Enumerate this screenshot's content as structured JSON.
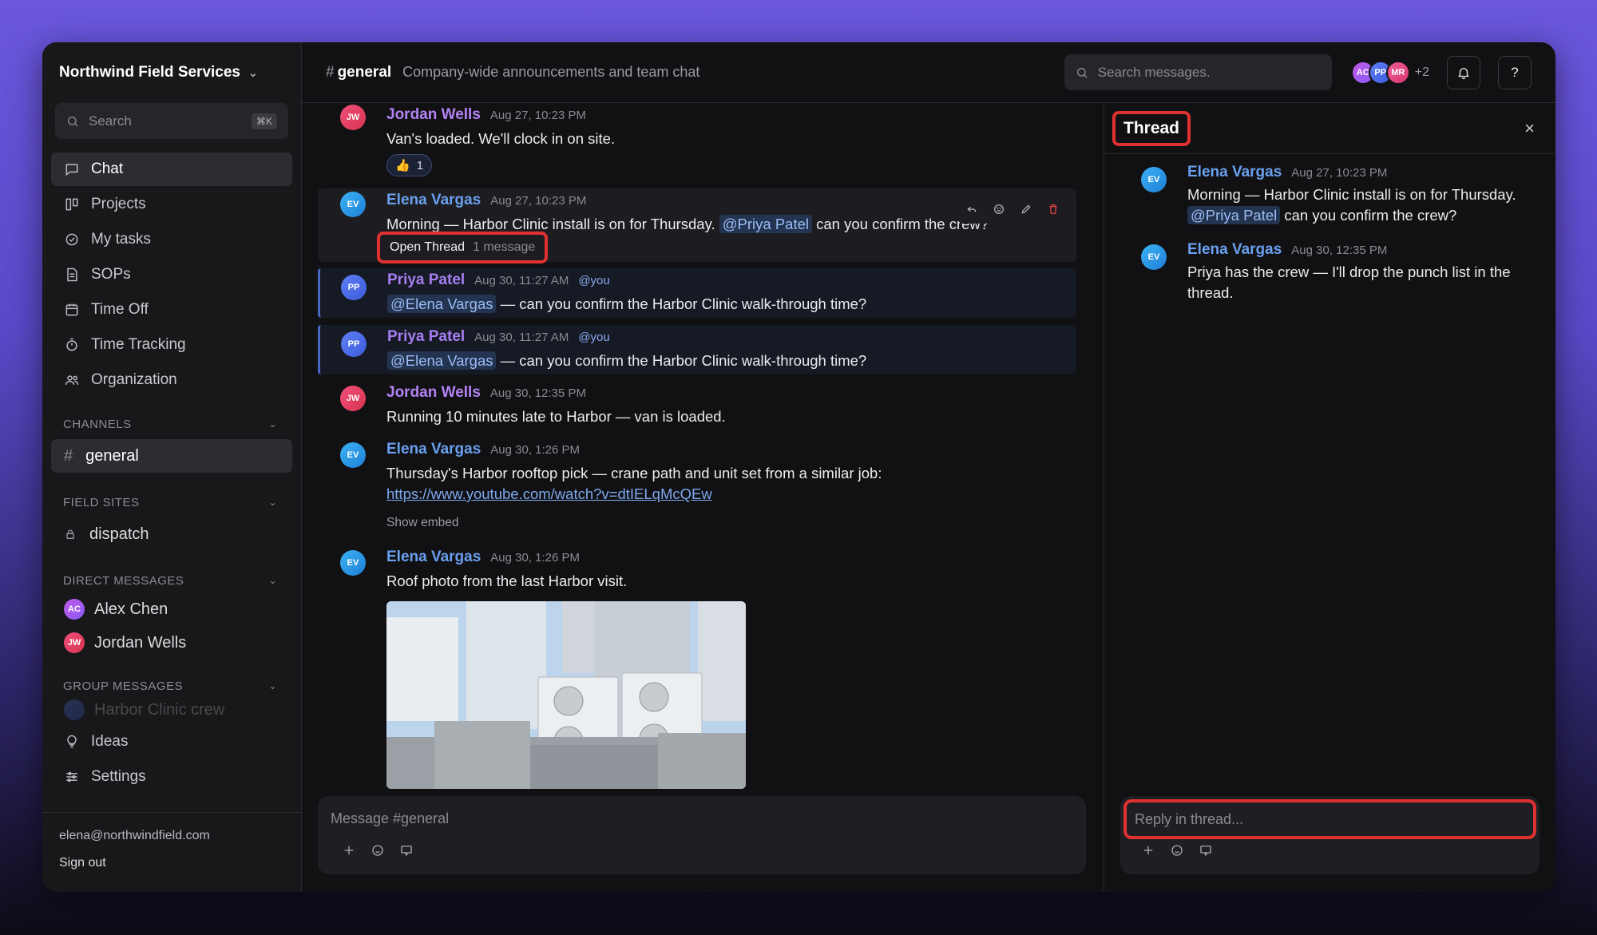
{
  "workspace": {
    "name": "Northwind Field Services"
  },
  "sidebar": {
    "search_placeholder": "Search",
    "search_shortcut": "⌘K",
    "nav": [
      {
        "label": "Chat"
      },
      {
        "label": "Projects"
      },
      {
        "label": "My tasks"
      },
      {
        "label": "SOPs"
      },
      {
        "label": "Time Off"
      },
      {
        "label": "Time Tracking"
      },
      {
        "label": "Organization"
      }
    ],
    "channels_label": "CHANNELS",
    "channels": [
      {
        "name": "general"
      }
    ],
    "field_sites_label": "FIELD SITES",
    "field_sites": [
      {
        "name": "dispatch"
      }
    ],
    "dm_label": "DIRECT MESSAGES",
    "dms": [
      {
        "initials": "AC",
        "name": "Alex Chen"
      },
      {
        "initials": "JW",
        "name": "Jordan Wells"
      }
    ],
    "group_label": "GROUP MESSAGES",
    "groups": [
      {
        "name": "Harbor Clinic crew"
      }
    ],
    "bottom_nav": [
      {
        "label": "Ideas"
      },
      {
        "label": "Settings"
      }
    ],
    "footer": {
      "email": "elena@northwindfield.com",
      "signout": "Sign out"
    }
  },
  "header": {
    "channel": "general",
    "hash": "#",
    "description": "Company-wide announcements and team chat",
    "search_placeholder": "Search messages.",
    "members": [
      "AC",
      "PP",
      "MR"
    ],
    "extra_members": "+2",
    "help": "?"
  },
  "messages": [
    {
      "initials": "JW",
      "author": "Jordan Wells",
      "time": "Aug 27, 10:23 PM",
      "text": "Van's loaded. We'll clock in on site.",
      "reaction_emoji": "👍",
      "reaction_count": "1"
    },
    {
      "initials": "EV",
      "author": "Elena Vargas",
      "time": "Aug 27, 10:23 PM",
      "text_before": "Morning — Harbor Clinic install is on for Thursday.",
      "mention": "@Priya Patel",
      "text_after": "can you confirm the crew?",
      "thread_label": "Open Thread",
      "thread_count": "1 message"
    },
    {
      "initials": "PP",
      "author": "Priya Patel",
      "time": "Aug 30, 11:27 AM",
      "you_tag": "@you",
      "mention": "@Elena Vargas",
      "text_after": "— can you confirm the Harbor Clinic walk-through time?"
    },
    {
      "initials": "PP",
      "author": "Priya Patel",
      "time": "Aug 30, 11:27 AM",
      "you_tag": "@you",
      "mention": "@Elena Vargas",
      "text_after": "— can you confirm the Harbor Clinic walk-through time?"
    },
    {
      "initials": "JW",
      "author": "Jordan Wells",
      "time": "Aug 30, 12:35 PM",
      "text": "Running 10 minutes late to Harbor — van is loaded."
    },
    {
      "initials": "EV",
      "author": "Elena Vargas",
      "time": "Aug 30, 1:26 PM",
      "text": "Thursday's Harbor rooftop pick — crane path and unit set from a similar job:",
      "link": "https://www.youtube.com/watch?v=dtIELqMcQEw",
      "show_embed": "Show embed"
    },
    {
      "initials": "EV",
      "author": "Elena Vargas",
      "time": "Aug 30, 1:26 PM",
      "text": "Roof photo from the last Harbor visit."
    }
  ],
  "composer": {
    "placeholder": "Message #general"
  },
  "thread": {
    "title": "Thread",
    "close": "×",
    "messages": [
      {
        "initials": "EV",
        "author": "Elena Vargas",
        "time": "Aug 27, 10:23 PM",
        "text_before": "Morning — Harbor Clinic install is on for Thursday.",
        "mention": "@Priya Patel",
        "text_after": "can you confirm the crew?"
      },
      {
        "initials": "EV",
        "author": "Elena Vargas",
        "time": "Aug 30, 12:35 PM",
        "text": "Priya has the crew — I'll drop the punch list in the thread."
      }
    ],
    "reply_placeholder": "Reply in thread..."
  }
}
